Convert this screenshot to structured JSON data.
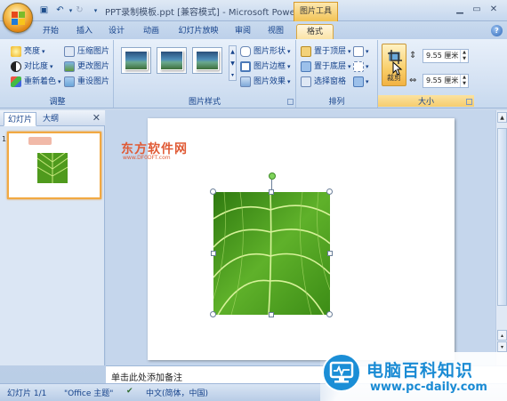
{
  "window": {
    "title": "PPT录制模板.ppt [兼容模式] - Microsoft PowerP...",
    "context_tools": "图片工具"
  },
  "tabs": [
    "开始",
    "插入",
    "设计",
    "动画",
    "幻灯片放映",
    "审阅",
    "视图",
    "格式"
  ],
  "ribbon": {
    "adjust": {
      "label": "调整",
      "brightness": "亮度",
      "contrast": "对比度",
      "recolor": "重新着色",
      "compress": "压缩图片",
      "change": "更改图片",
      "reset": "重设图片"
    },
    "picture_styles": {
      "label": "图片样式",
      "shape": "图片形状",
      "border": "图片边框",
      "effects": "图片效果"
    },
    "arrange": {
      "label": "排列",
      "bring_front": "置于顶层",
      "send_back": "置于底层",
      "selection_pane": "选择窗格"
    },
    "size": {
      "label": "大小",
      "crop": "裁剪",
      "height": "9.55 厘米",
      "width": "9.55 厘米"
    }
  },
  "slides_pane": {
    "tab_slides": "幻灯片",
    "tab_outline": "大纲",
    "slide_number": "1"
  },
  "slide": {
    "watermark_title": "东方软件网",
    "watermark_url": "www.DF0DFT.com"
  },
  "notes": {
    "placeholder": "单击此处添加备注"
  },
  "status": {
    "slide_indicator": "幻灯片 1/1",
    "theme": "\"Office 主题\"",
    "language": "中文(简体，中国)"
  },
  "brand": {
    "title": "电脑百科知识",
    "url": "www.pc-daily.com"
  }
}
